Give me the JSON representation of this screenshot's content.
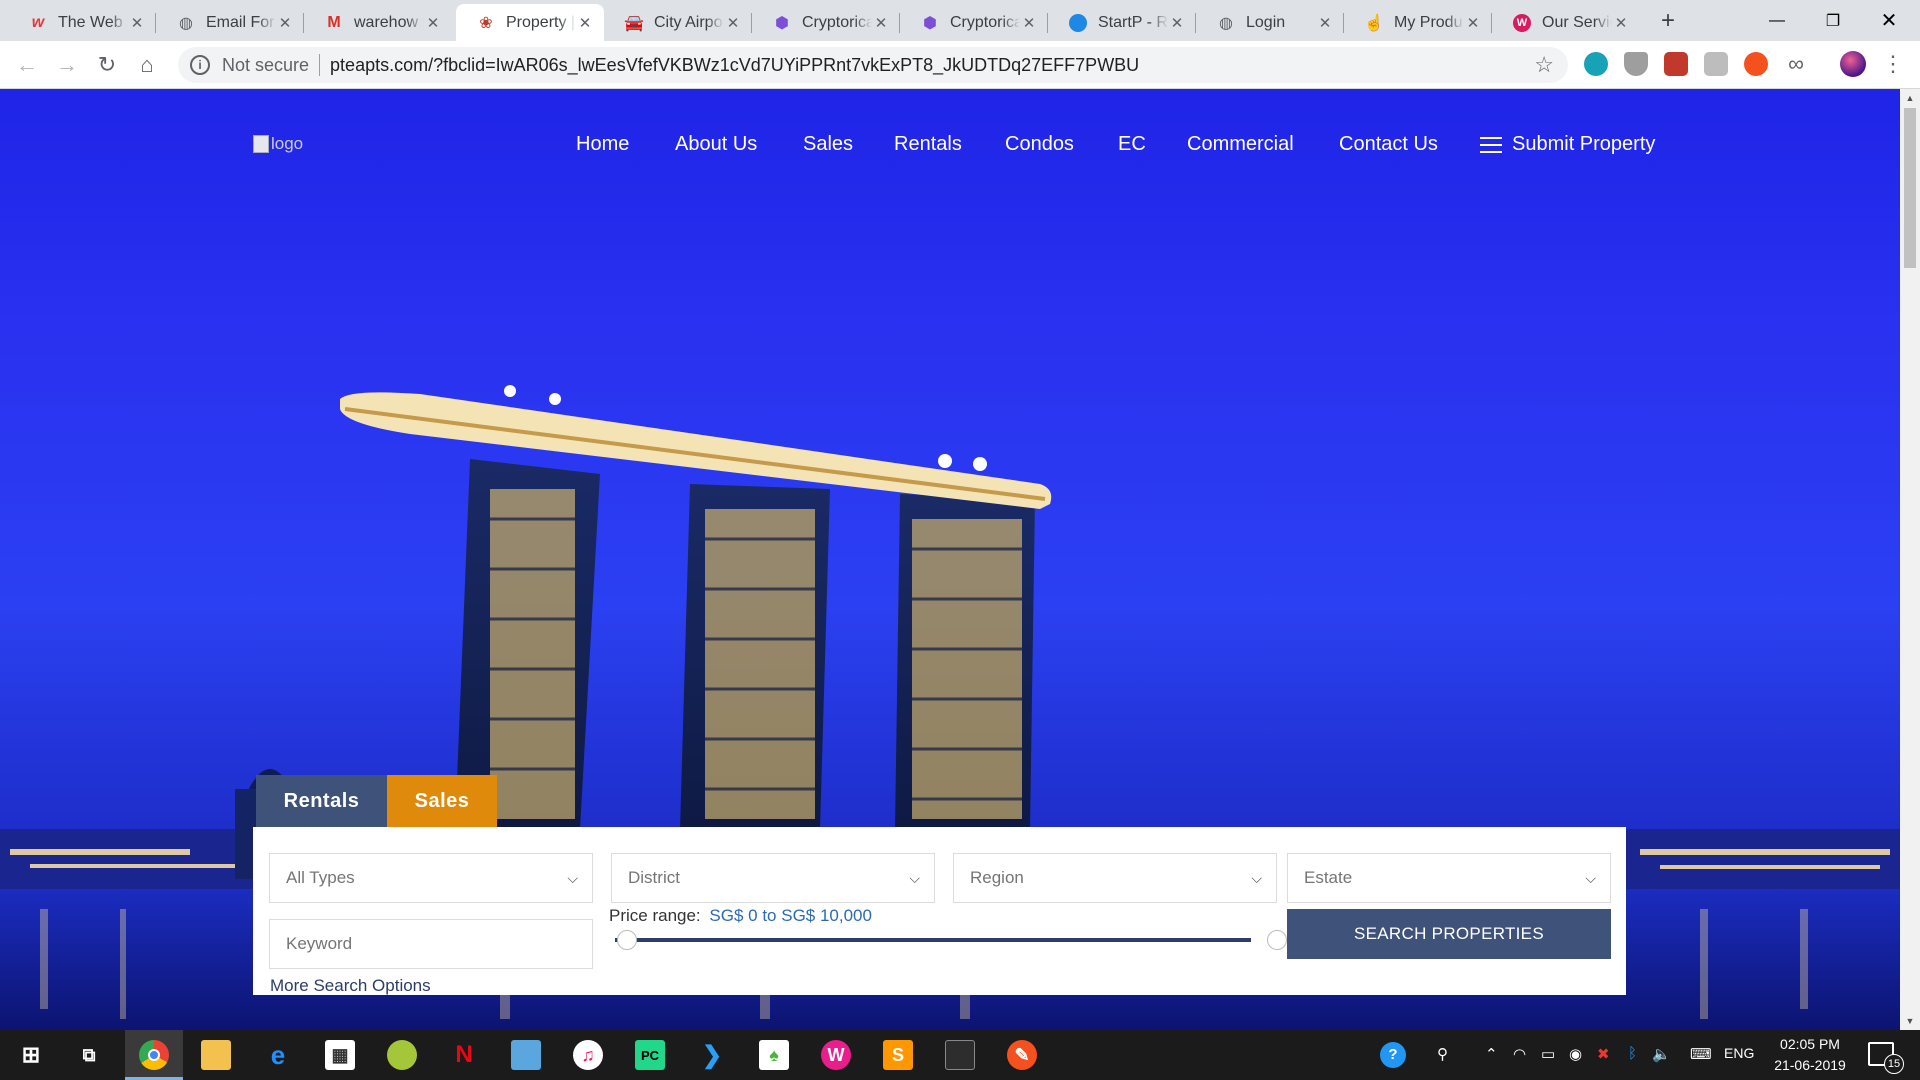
{
  "browser": {
    "tabs": [
      {
        "title": "The Web D",
        "icon": "webflow-w-icon",
        "color": "#e53935"
      },
      {
        "title": "Email Form",
        "icon": "globe-icon",
        "color": "#5f6368"
      },
      {
        "title": "warehow t",
        "icon": "gmail-icon",
        "color": "#d93025"
      },
      {
        "title": "Property |",
        "icon": "property-site-icon",
        "color": "#c0392b"
      },
      {
        "title": "City Airpo",
        "icon": "car-icon",
        "color": "#1a73e8"
      },
      {
        "title": "Cryptorica",
        "icon": "cube-icon",
        "color": "#7b4fd6"
      },
      {
        "title": "Cryptorica",
        "icon": "cube-icon",
        "color": "#7b4fd6"
      },
      {
        "title": "StartP - Re",
        "icon": "startp-icon",
        "color": "#1e88e5"
      },
      {
        "title": "Login",
        "icon": "globe-icon",
        "color": "#5f6368"
      },
      {
        "title": "My Produ",
        "icon": "hand-icon",
        "color": "#8d6e63"
      },
      {
        "title": "Our Servic",
        "icon": "webflow-circle-icon",
        "color": "#d81b60"
      }
    ],
    "active_tab": 3,
    "security_label": "Not secure",
    "url": "pteapts.com/?fbclid=IwAR06s_lwEesVfefVKBWz1cVd7UYiPPRnt7vkExPT8_JkUDTDq27EFF7PWBU"
  },
  "site": {
    "logo_alt": "logo",
    "nav": [
      "Home",
      "About Us",
      "Sales",
      "Rentals",
      "Condos",
      "EC",
      "Commercial",
      "Contact Us"
    ],
    "submit_label": "Submit Property",
    "search": {
      "tabs": [
        "Rentals",
        "Sales"
      ],
      "active_tab": "Sales",
      "selects": {
        "type": "All Types",
        "district": "District",
        "region": "Region",
        "estate": "Estate"
      },
      "keyword_placeholder": "Keyword",
      "price_label": "Price range:",
      "price_range": "SG$ 0 to SG$ 10,000",
      "search_button": "SEARCH PROPERTIES",
      "more_options": "More Search Options"
    }
  },
  "taskbar": {
    "language": "ENG",
    "time": "02:05 PM",
    "date": "21-06-2019",
    "notification_count": "15"
  },
  "colors": {
    "hero_blue": "#2a31f0",
    "search_button": "#3f5279",
    "rentals_tab": "#3f5279",
    "sales_tab": "#e08a0b",
    "link_blue": "#2d6ab2"
  }
}
